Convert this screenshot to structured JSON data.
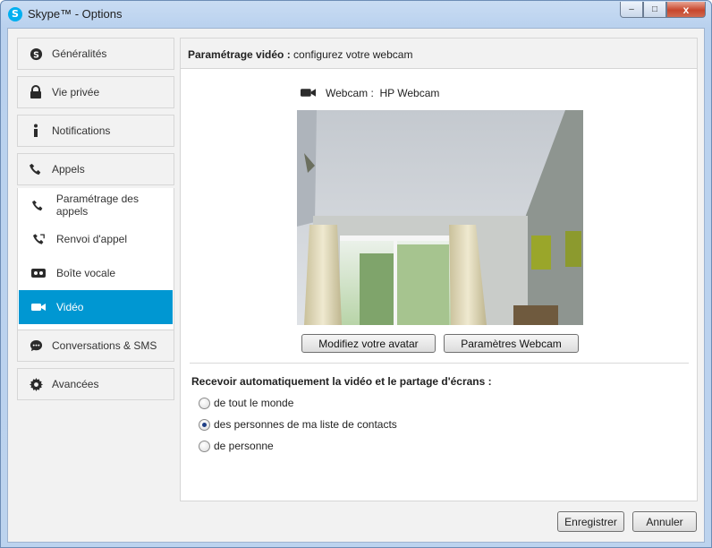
{
  "window": {
    "title": "Skype™ - Options",
    "app_icon": "skype-icon",
    "controls": {
      "minimize": "–",
      "maximize": "□",
      "close": "x"
    }
  },
  "sidebar": {
    "items": [
      {
        "label": "Généralités",
        "icon": "skype-icon"
      },
      {
        "label": "Vie privée",
        "icon": "lock-icon"
      },
      {
        "label": "Notifications",
        "icon": "info-icon"
      },
      {
        "label": "Appels",
        "icon": "phone-icon"
      }
    ],
    "sub_items": [
      {
        "label": "Paramétrage des appels",
        "icon": "phone-icon",
        "active": false
      },
      {
        "label": "Renvoi d'appel",
        "icon": "call-forward-icon",
        "active": false
      },
      {
        "label": "Boîte vocale",
        "icon": "voicemail-icon",
        "active": false
      },
      {
        "label": "Vidéo",
        "icon": "video-camera-icon",
        "active": true
      }
    ],
    "bottom_items": [
      {
        "label": "Conversations & SMS",
        "icon": "chat-icon"
      },
      {
        "label": "Avancées",
        "icon": "gear-icon"
      }
    ]
  },
  "main": {
    "header_bold": "Paramétrage vidéo :",
    "header_rest": " configurez votre webcam",
    "webcam_label": "Webcam :",
    "webcam_name": "HP Webcam",
    "avatar_button": "Modifiez votre avatar",
    "webcam_settings_button": "Paramètres Webcam",
    "receive_title": "Recevoir automatiquement la vidéo et le partage d'écrans :",
    "options": [
      {
        "label": "de tout le monde",
        "checked": false
      },
      {
        "label": "des personnes de ma liste de contacts",
        "checked": true
      },
      {
        "label": "de personne",
        "checked": false
      }
    ]
  },
  "footer": {
    "save_label": "Enregistrer",
    "cancel_label": "Annuler"
  },
  "colors": {
    "accent": "#0097d2",
    "skype_blue": "#00aff0"
  }
}
